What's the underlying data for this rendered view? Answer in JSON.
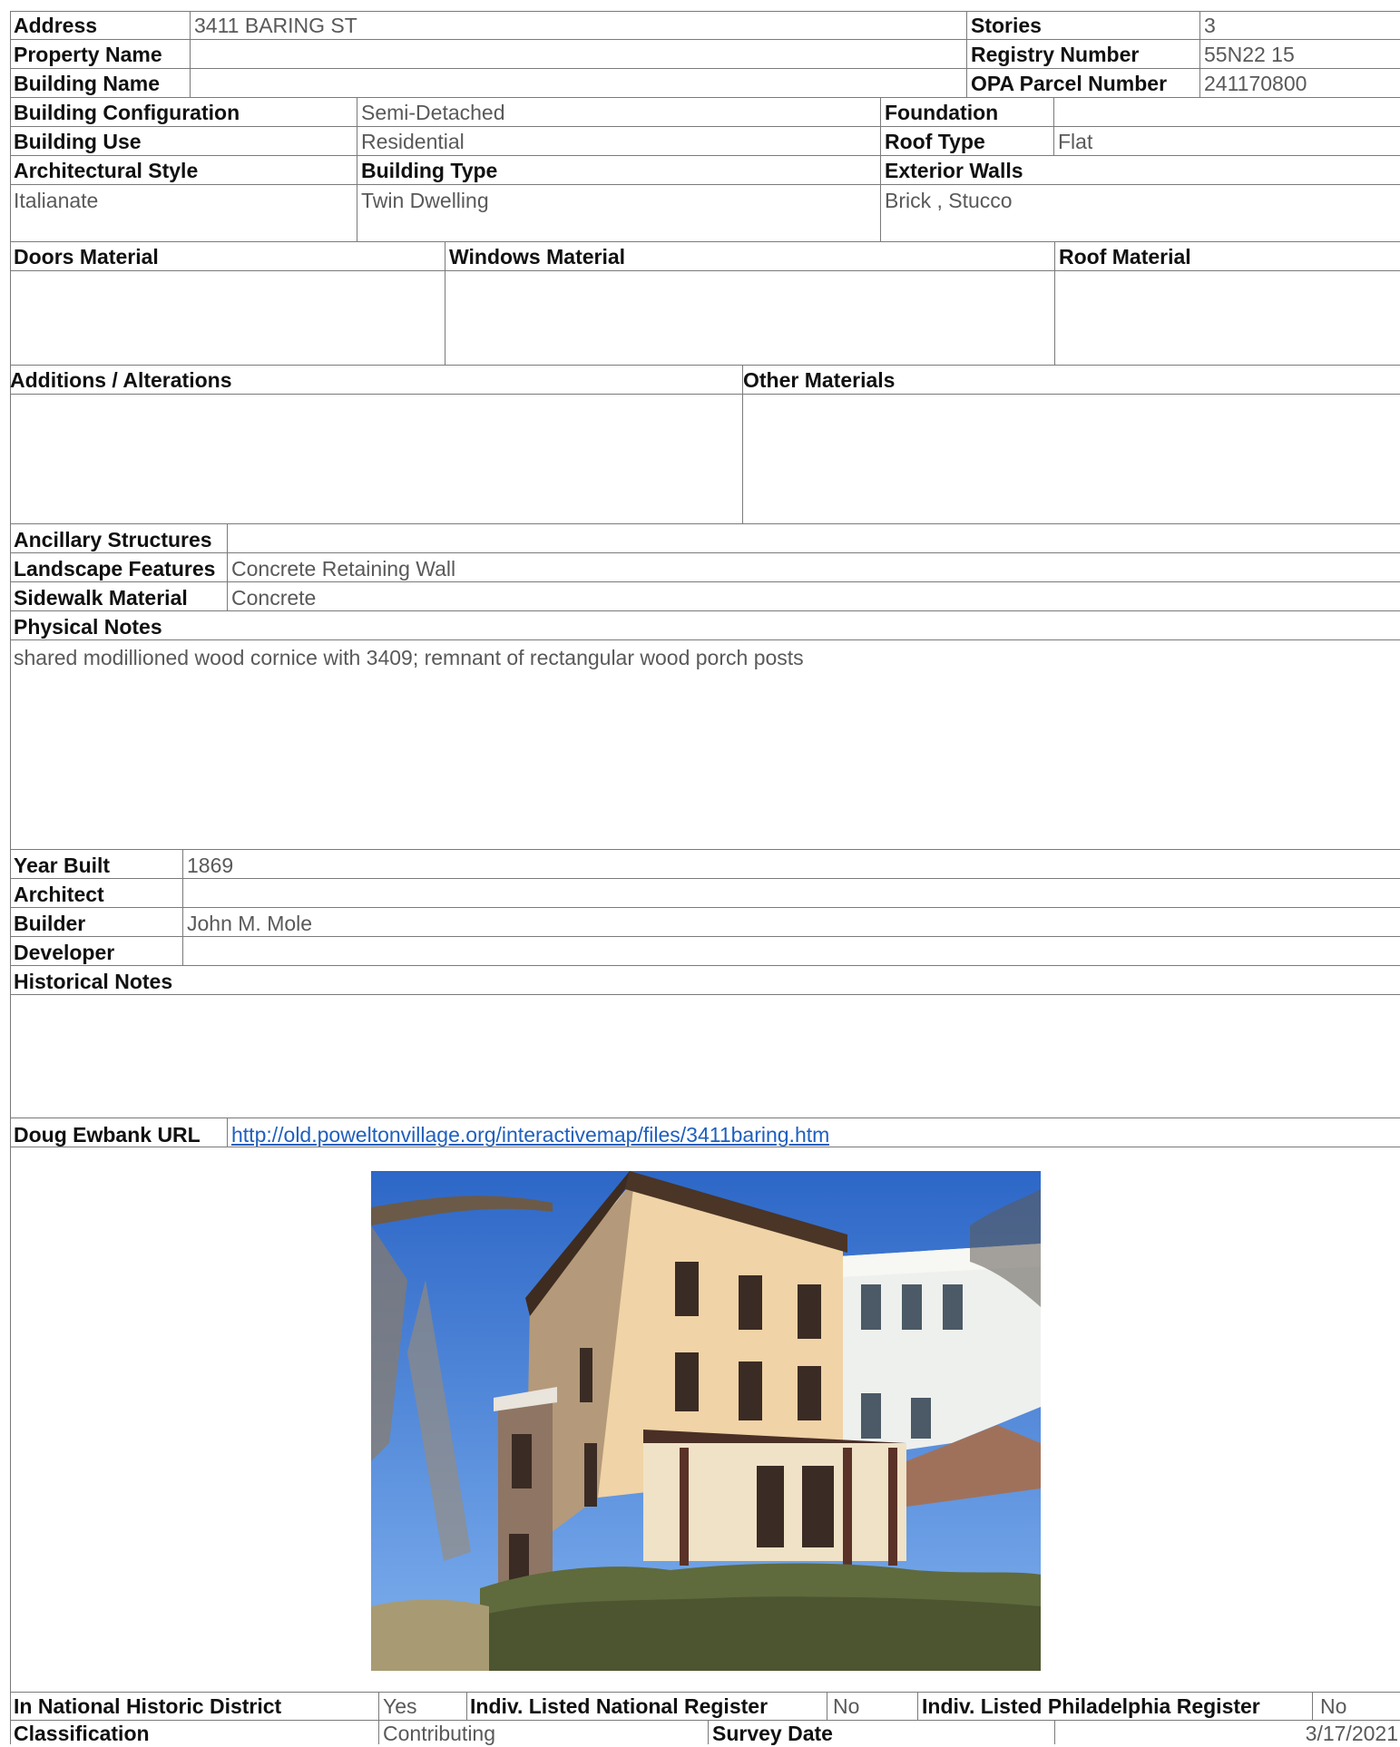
{
  "header": {
    "address_label": "Address",
    "address": "3411 BARING ST",
    "stories_label": "Stories",
    "stories": "3",
    "property_name_label": "Property Name",
    "property_name": "",
    "registry_number_label": "Registry Number",
    "registry_number": "55N22 15",
    "building_name_label": "Building Name",
    "building_name": "",
    "opa_parcel_label": "OPA Parcel Number",
    "opa_parcel": "241170800"
  },
  "config": {
    "building_configuration_label": "Building Configuration",
    "building_configuration": "Semi-Detached",
    "foundation_label": "Foundation",
    "foundation": "",
    "building_use_label": "Building Use",
    "building_use": "Residential",
    "roof_type_label": "Roof Type",
    "roof_type": "Flat",
    "architectural_style_label": "Architectural Style",
    "architectural_style": "Italianate",
    "building_type_label": "Building Type",
    "building_type": "Twin Dwelling",
    "exterior_walls_label": "Exterior Walls",
    "exterior_walls": "Brick , Stucco"
  },
  "materials": {
    "doors_label": "Doors Material",
    "doors": "",
    "windows_label": "Windows Material",
    "windows": "",
    "roof_label": "Roof Material",
    "roof": ""
  },
  "alterations": {
    "additions_label": "Additions / Alterations",
    "additions": "",
    "other_materials_label": "Other Materials",
    "other_materials": ""
  },
  "site": {
    "ancillary_label": "Ancillary Structures",
    "ancillary": "",
    "landscape_label": "Landscape Features",
    "landscape": "Concrete Retaining Wall",
    "sidewalk_label": "Sidewalk Material",
    "sidewalk": "Concrete",
    "physical_notes_label": "Physical Notes",
    "physical_notes": "shared modillioned wood cornice with 3409; remnant of rectangular wood porch posts"
  },
  "history": {
    "year_built_label": "Year Built",
    "year_built": "1869",
    "architect_label": "Architect",
    "architect": "",
    "builder_label": "Builder",
    "builder": "John M. Mole",
    "developer_label": "Developer",
    "developer": "",
    "historical_notes_label": "Historical Notes",
    "historical_notes": ""
  },
  "links": {
    "ewbank_label": "Doug Ewbank URL",
    "ewbank_url": "http://old.poweltonvillage.org/interactivemap/files/3411baring.htm"
  },
  "status": {
    "national_district_label": "In National Historic District",
    "national_district": "Yes",
    "national_register_label": "Indiv. Listed National Register",
    "national_register": "No",
    "philadelphia_register_label": "Indiv. Listed Philadelphia Register",
    "philadelphia_register": "No",
    "classification_label": "Classification",
    "classification": "Contributing",
    "survey_date_label": "Survey Date",
    "survey_date": "3/17/2021"
  }
}
